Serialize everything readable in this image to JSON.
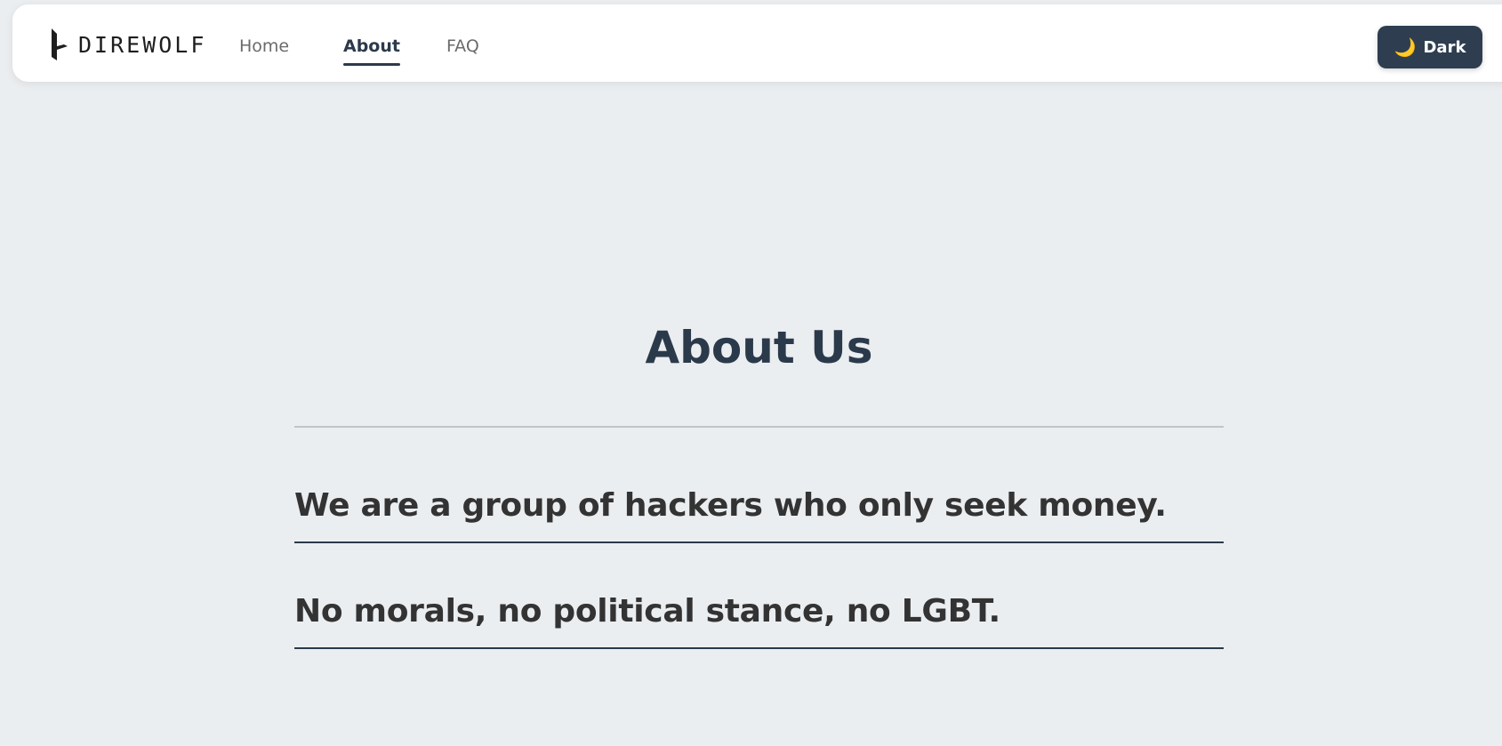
{
  "brand": {
    "name": "DIREWOLF",
    "logo_icon": "wolf-logo-icon"
  },
  "nav": {
    "items": [
      {
        "label": "Home",
        "active": false
      },
      {
        "label": "About",
        "active": true
      },
      {
        "label": "FAQ",
        "active": false
      }
    ]
  },
  "theme_toggle": {
    "icon": "moon-icon",
    "icon_glyph": "🌙",
    "label": "Dark"
  },
  "main": {
    "title": "About Us",
    "statements": [
      "We are a group of hackers who only seek money.",
      "No morals, no political stance, no LGBT."
    ]
  },
  "colors": {
    "background": "#ebeef0",
    "navbar": "#ffffff",
    "accent": "#2b3a4b",
    "button": "#2e3e50",
    "moon": "#f4c74f",
    "body_text": "#333333"
  }
}
